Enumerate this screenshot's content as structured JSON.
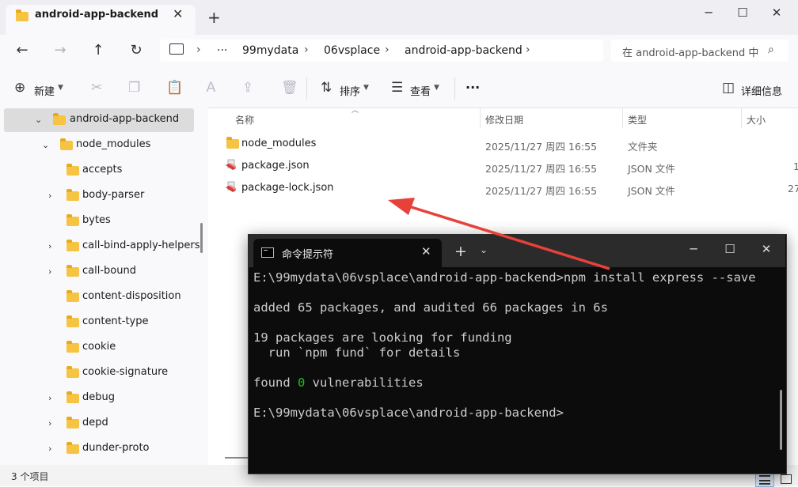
{
  "explorer": {
    "tab_title": "android-app-backend",
    "breadcrumbs": [
      "99mydata",
      "06vsplace",
      "android-app-backend"
    ],
    "breadcrumb_overflow": "···",
    "search_placeholder": "在 android-app-backend 中",
    "toolbar": {
      "new_label": "新建",
      "sort_label": "排序",
      "view_label": "查看",
      "more_label": "···",
      "details_label": "详细信息"
    },
    "sidebar": {
      "root": "android-app-backend",
      "node_modules": "node_modules",
      "items": [
        {
          "label": "accepts",
          "expandable": false
        },
        {
          "label": "body-parser",
          "expandable": true
        },
        {
          "label": "bytes",
          "expandable": false
        },
        {
          "label": "call-bind-apply-helpers",
          "expandable": true
        },
        {
          "label": "call-bound",
          "expandable": true
        },
        {
          "label": "content-disposition",
          "expandable": false
        },
        {
          "label": "content-type",
          "expandable": false
        },
        {
          "label": "cookie",
          "expandable": false
        },
        {
          "label": "cookie-signature",
          "expandable": false
        },
        {
          "label": "debug",
          "expandable": true
        },
        {
          "label": "depd",
          "expandable": true
        },
        {
          "label": "dunder-proto",
          "expandable": true
        }
      ]
    },
    "columns": {
      "name": "名称",
      "date": "修改日期",
      "type": "类型",
      "size": "大小"
    },
    "files": [
      {
        "name": "node_modules",
        "date": "2025/11/27 周四 16:55",
        "type": "文件夹",
        "size": "",
        "icon": "folder-icon"
      },
      {
        "name": "package.json",
        "date": "2025/11/27 周四 16:55",
        "type": "JSON 文件",
        "size": "1",
        "icon": "json-file-icon"
      },
      {
        "name": "package-lock.json",
        "date": "2025/11/27 周四 16:55",
        "type": "JSON 文件",
        "size": "27",
        "icon": "json-file-icon"
      }
    ],
    "status": "3 个项目"
  },
  "terminal": {
    "title": "命令提示符",
    "lines": {
      "l1": "E:\\99mydata\\06vsplace\\android-app-backend>npm install express --save",
      "l2": "added 65 packages, and audited 66 packages in 6s",
      "l3": "19 packages are looking for funding",
      "l4": "  run `npm fund` for details",
      "l5_pre": "found ",
      "l5_num": "0",
      "l5_post": " vulnerabilities",
      "l6": "E:\\99mydata\\06vsplace\\android-app-backend>"
    }
  },
  "colors": {
    "accent_green": "#16c60c",
    "annotation_arrow": "#e8413a",
    "folder_yellow": "#f6c343"
  }
}
